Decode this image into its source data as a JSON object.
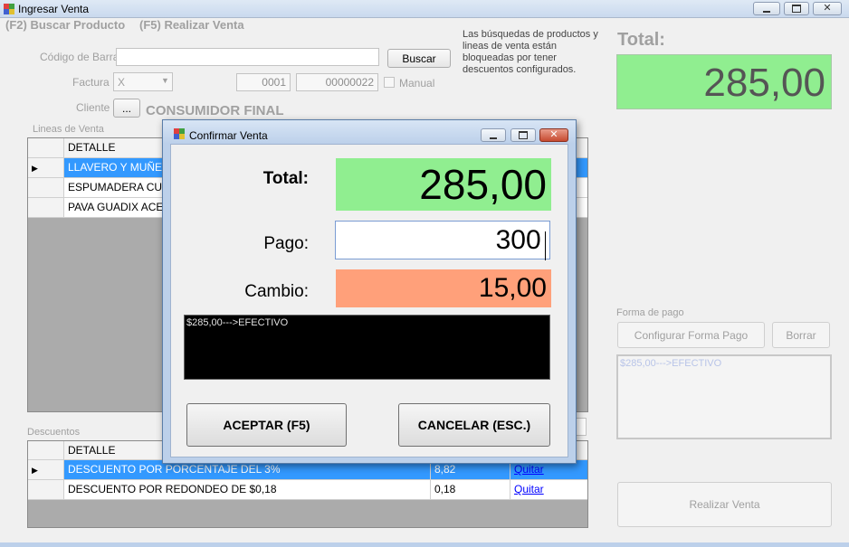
{
  "window": {
    "title": "Ingresar Venta"
  },
  "shortcuts": {
    "search": "(F2) Buscar Producto",
    "sale": "(F5) Realizar Venta"
  },
  "notice": "Las búsquedas de productos y lineas de venta están bloqueadas por tener descuentos configurados.",
  "form": {
    "barcode_label": "Código de Barra",
    "barcode_value": "",
    "search_button": "Buscar",
    "invoice_label": "Factura",
    "invoice_type": "X",
    "point_of_sale": "0001",
    "invoice_number": "00000022",
    "manual_label": "Manual",
    "client_label": "Cliente",
    "client_button": "...",
    "client_name": "CONSUMIDOR FINAL"
  },
  "total_panel": {
    "label": "Total:",
    "value": "285,00"
  },
  "lines": {
    "title": "Lineas de Venta",
    "header": "DETALLE",
    "rows": [
      "LLAVERO Y MUÑECO",
      "ESPUMADERA CUTL",
      "PAVA  GUADIX ACER"
    ]
  },
  "discounts": {
    "title": "Descuentos",
    "header": "DETALLE",
    "rows": [
      {
        "detail": "DESCUENTO POR PORCENTAJE DEL 3%",
        "amount": "8,82",
        "action": "Quitar"
      },
      {
        "detail": "DESCUENTO POR REDONDEO DE $0,18",
        "amount": "0,18",
        "action": "Quitar"
      }
    ]
  },
  "payment": {
    "title": "Forma de pago",
    "configure_button": "Configurar Forma Pago",
    "clear_button": "Borrar",
    "summary": "$285,00--->EFECTIVO"
  },
  "sale_button": "Realizar Venta",
  "dialog": {
    "title": "Confirmar Venta",
    "total_label": "Total:",
    "total_value": "285,00",
    "payment_label": "Pago:",
    "payment_value": "300",
    "change_label": "Cambio:",
    "change_value": "15,00",
    "summary": "$285,00--->EFECTIVO",
    "accept_button": "ACEPTAR (F5)",
    "cancel_button": "CANCELAR (ESC.)"
  },
  "colors": {
    "total_green": "#90ee90",
    "change_salmon": "#ffa07a",
    "selection_blue": "#3399ff"
  }
}
